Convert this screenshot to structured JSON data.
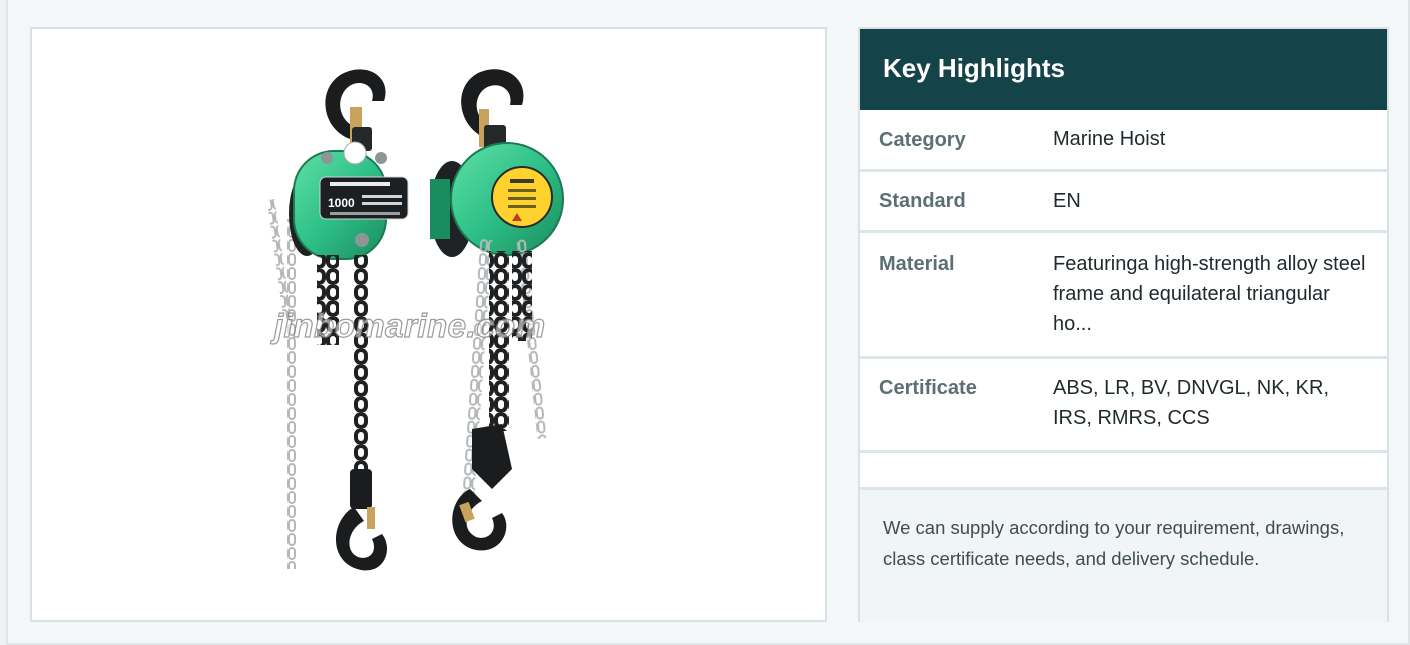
{
  "product_image": {
    "alt": "Green manual chain hoists",
    "watermark": "jinbomarine.com",
    "nameplate_capacity": "1000"
  },
  "highlights": {
    "title": "Key Highlights",
    "rows": [
      {
        "label": "Category",
        "value": "Marine Hoist"
      },
      {
        "label": "Standard",
        "value": "EN"
      },
      {
        "label": "Material",
        "value": "Featuringa high-strength alloy steel frame and equilateral triangular ho..."
      },
      {
        "label": "Certificate",
        "value": "ABS, LR, BV, DNVGL, NK, KR, IRS, RMRS, CCS"
      }
    ],
    "note": "We can supply according to your requirement, drawings, class certificate needs, and delivery schedule."
  },
  "colors": {
    "header_bg": "#15434a",
    "hoist_green": "#2fc28a",
    "label_text": "#5c7073"
  }
}
